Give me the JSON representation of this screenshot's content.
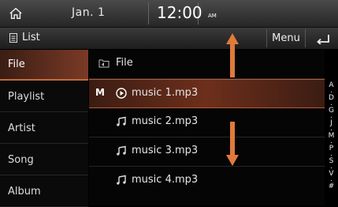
{
  "status": {
    "date": "Jan. 1",
    "time": "12:00",
    "ampm": "AM"
  },
  "header": {
    "title": "List",
    "menu_label": "Menu"
  },
  "categories": [
    {
      "label": "File",
      "active": true
    },
    {
      "label": "Playlist",
      "active": false
    },
    {
      "label": "Artist",
      "active": false
    },
    {
      "label": "Song",
      "active": false
    },
    {
      "label": "Album",
      "active": false
    }
  ],
  "list": {
    "folder": "File",
    "items": [
      {
        "marker": "M",
        "name": "music 1.mp3",
        "playing": true
      },
      {
        "marker": "",
        "name": "music 2.mp3",
        "playing": false
      },
      {
        "marker": "",
        "name": "music 3.mp3",
        "playing": false
      },
      {
        "marker": "",
        "name": "music 4.mp3",
        "playing": false
      }
    ]
  },
  "alpha_index": [
    "A",
    ".",
    "D",
    ".",
    "G",
    ".",
    "J",
    ".",
    "M",
    ".",
    "P",
    ".",
    "S",
    ".",
    "V",
    ".",
    "#"
  ],
  "colors": {
    "accent": "#c26a3c",
    "arrow": "#e07a3c"
  }
}
